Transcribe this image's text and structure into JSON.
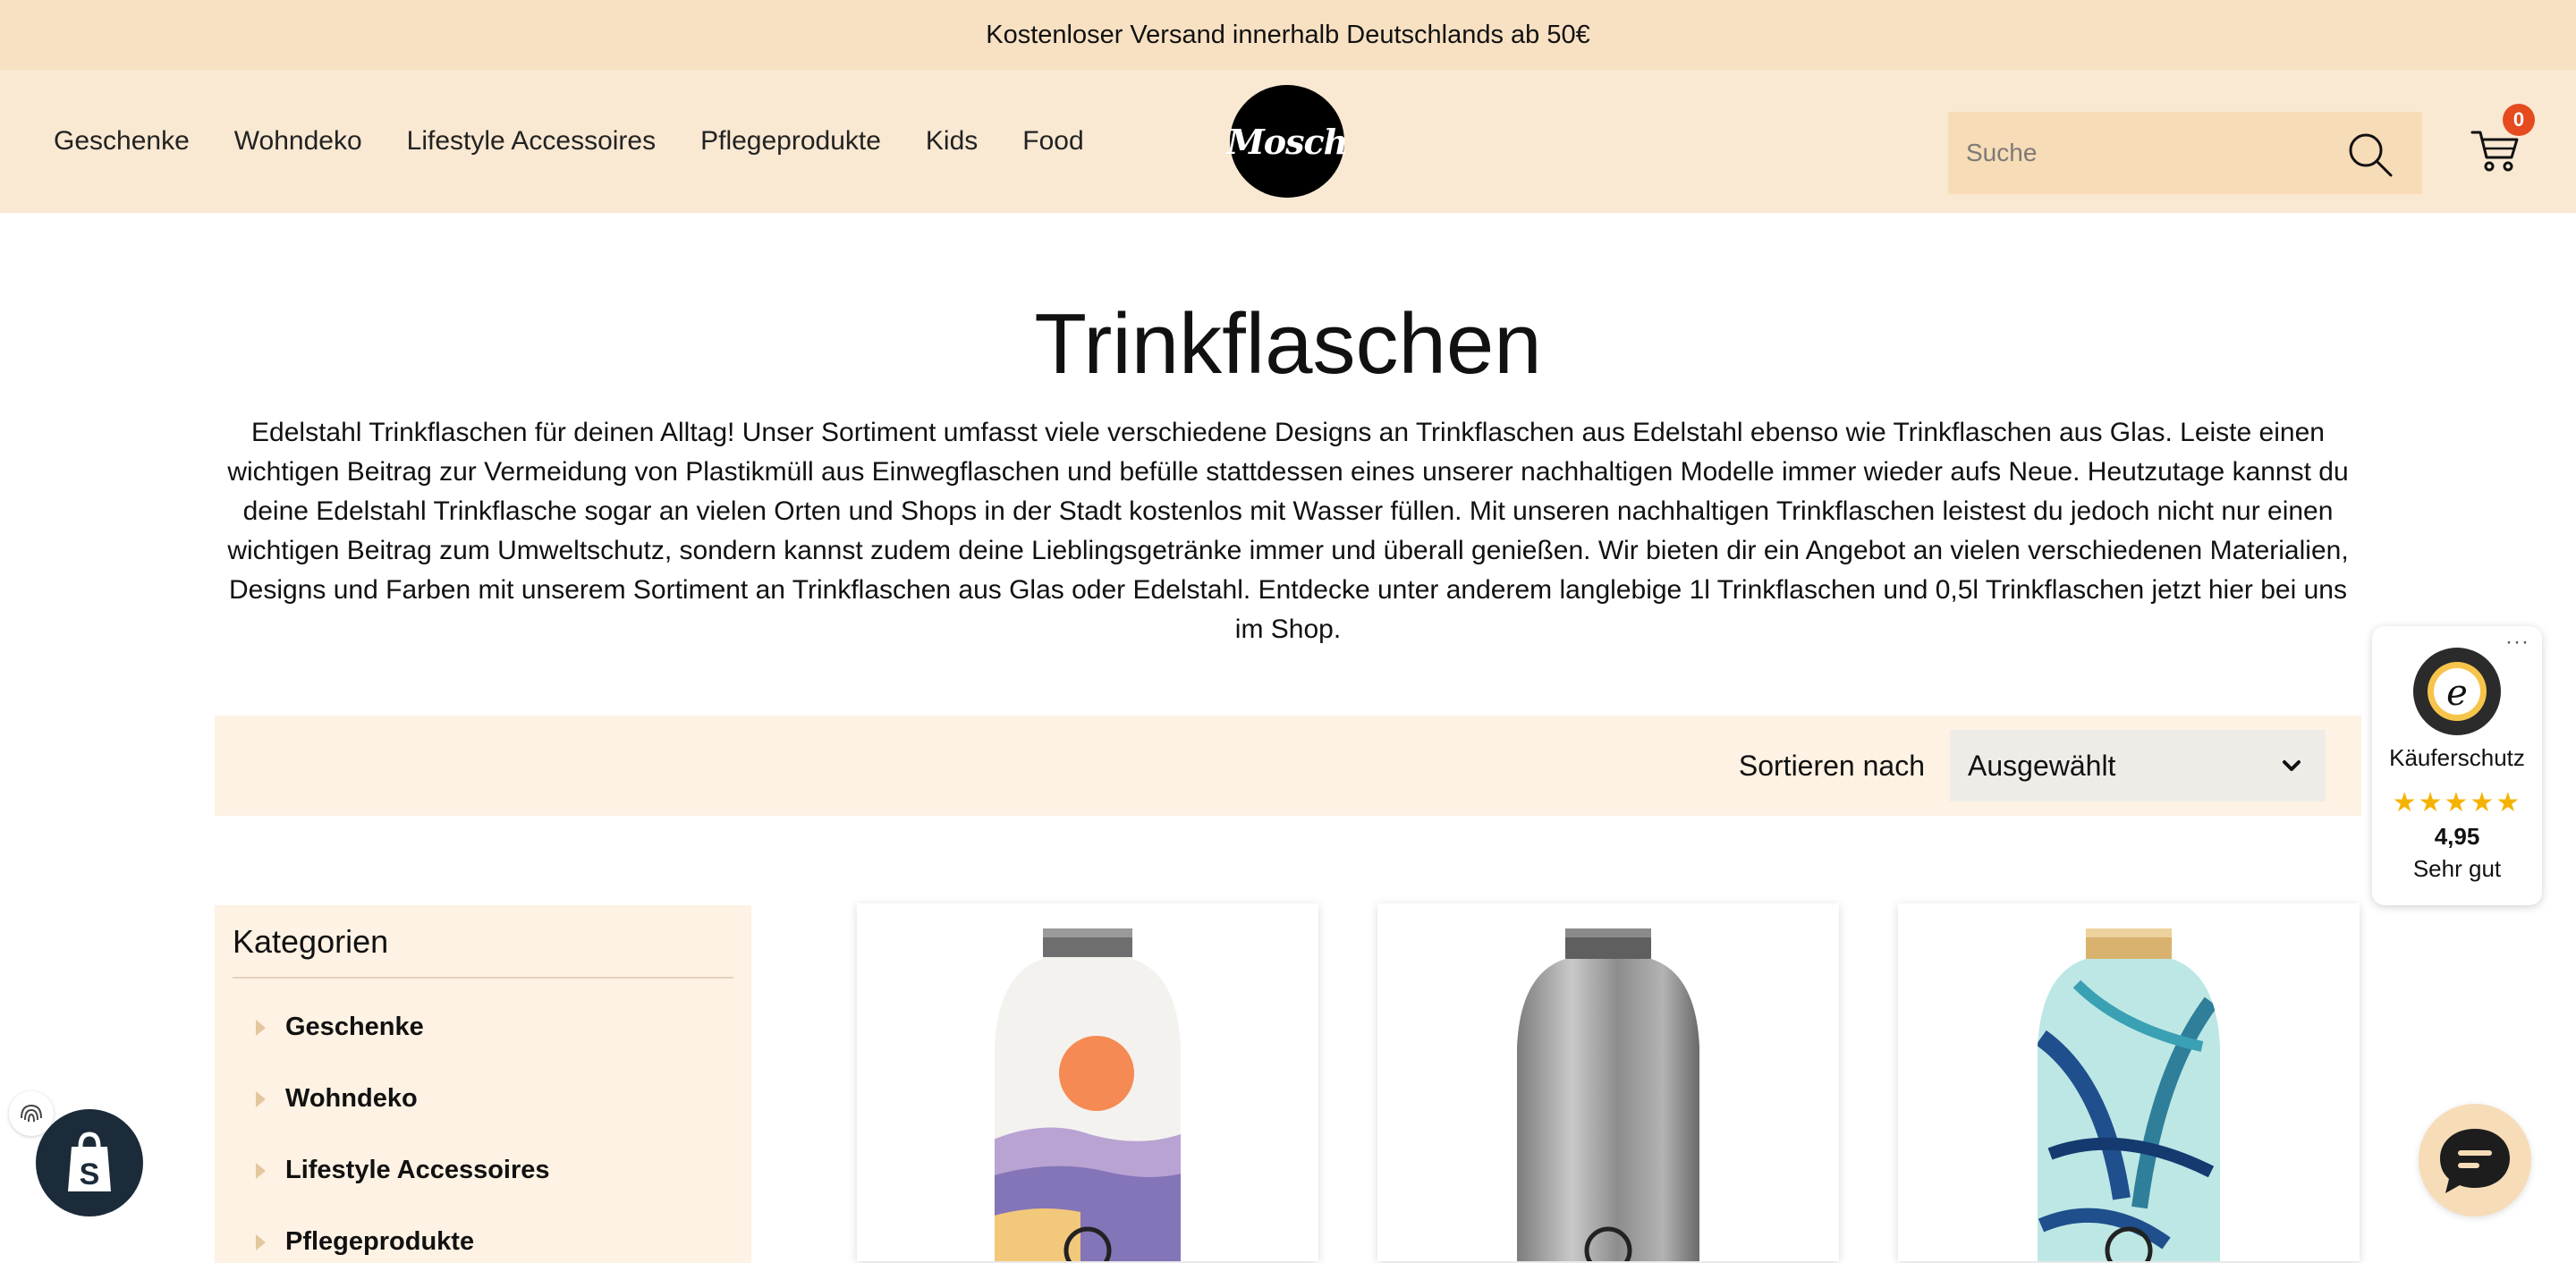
{
  "announcement": "Kostenloser Versand innerhalb Deutschlands ab 50€",
  "nav": [
    "Geschenke",
    "Wohndeko",
    "Lifestyle Accessoires",
    "Pflegeprodukte",
    "Kids",
    "Food"
  ],
  "logo_text": "Mosch",
  "search": {
    "placeholder": "Suche",
    "icon": "search-icon"
  },
  "cart": {
    "count": "0",
    "icon": "cart-icon"
  },
  "page": {
    "title": "Trinkflaschen",
    "description": "Edelstahl Trinkflaschen für deinen Alltag! Unser Sortiment umfasst viele verschiedene Designs an Trinkflaschen aus Edelstahl ebenso wie Trinkflaschen aus Glas. Leiste einen wichtigen Beitrag zur Vermeidung von Plastikmüll aus Einwegflaschen und befülle stattdessen eines unserer nachhaltigen Modelle immer wieder aufs Neue. Heutzutage kannst du deine Edelstahl Trinkflasche sogar an vielen Orten und Shops in der Stadt kostenlos mit Wasser füllen. Mit unseren nachhaltigen Trinkflaschen leistest du jedoch nicht nur einen wichtigen Beitrag zum Umweltschutz, sondern kannst zudem deine Lieblingsgetränke immer und überall genießen. Wir bieten dir ein Angebot an vielen verschiedenen Materialien, Designs und Farben mit unserem Sortiment an Trinkflaschen aus Glas oder Edelstahl. Entdecke unter anderem langlebige 1l Trinkflaschen und 0,5l Trinkflaschen jetzt hier bei uns im Shop."
  },
  "sort": {
    "label": "Sortieren nach",
    "selected": "Ausgewählt"
  },
  "sidebar": {
    "heading": "Kategorien",
    "items": [
      "Geschenke",
      "Wohndeko",
      "Lifestyle Accessoires",
      "Pflegeprodukte"
    ]
  },
  "products": [
    {
      "design": "landscape-sunset"
    },
    {
      "design": "brushed-steel"
    },
    {
      "design": "tropical-leaves"
    }
  ],
  "trusted_shops": {
    "label": "Käuferschutz",
    "rating": "4,95",
    "verdict": "Sehr gut",
    "stars": "★★★★★",
    "more": "···"
  },
  "colors": {
    "announce_bg": "#f8e1c2",
    "header_bg": "#f9e8d2",
    "panel_bg": "#fdf2e3",
    "badge": "#e54b1f"
  }
}
